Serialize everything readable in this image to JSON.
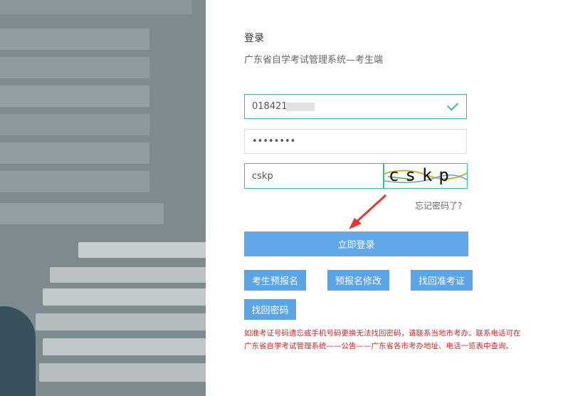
{
  "header": {
    "title": "登录",
    "subtitle": "广东省自学考试管理系统—考生端"
  },
  "form": {
    "username_value": "018421",
    "password_value": "••••••••",
    "captcha_value": "cskp",
    "captcha_image_text": "cskp",
    "forgot_label": "忘记密码了?",
    "login_label": "立即登录"
  },
  "actions": {
    "preregister_label": "考生预报名",
    "modify_label": "预报名修改",
    "recover_ticket_label": "找回准考证",
    "recover_password_label": "找回密码"
  },
  "notice": {
    "line1": "如准考证号码遗忘或手机号码更换无法找回密码，请联系当地市考办。联系电话可在",
    "line2": "广东省自学考试管理系统——公告——广东省各市考办地址、电话一览表中查询。"
  },
  "colors": {
    "accent": "#60a8ea",
    "valid": "#3dbf8d",
    "warning": "#d12a2a",
    "arrow": "#e53935"
  }
}
